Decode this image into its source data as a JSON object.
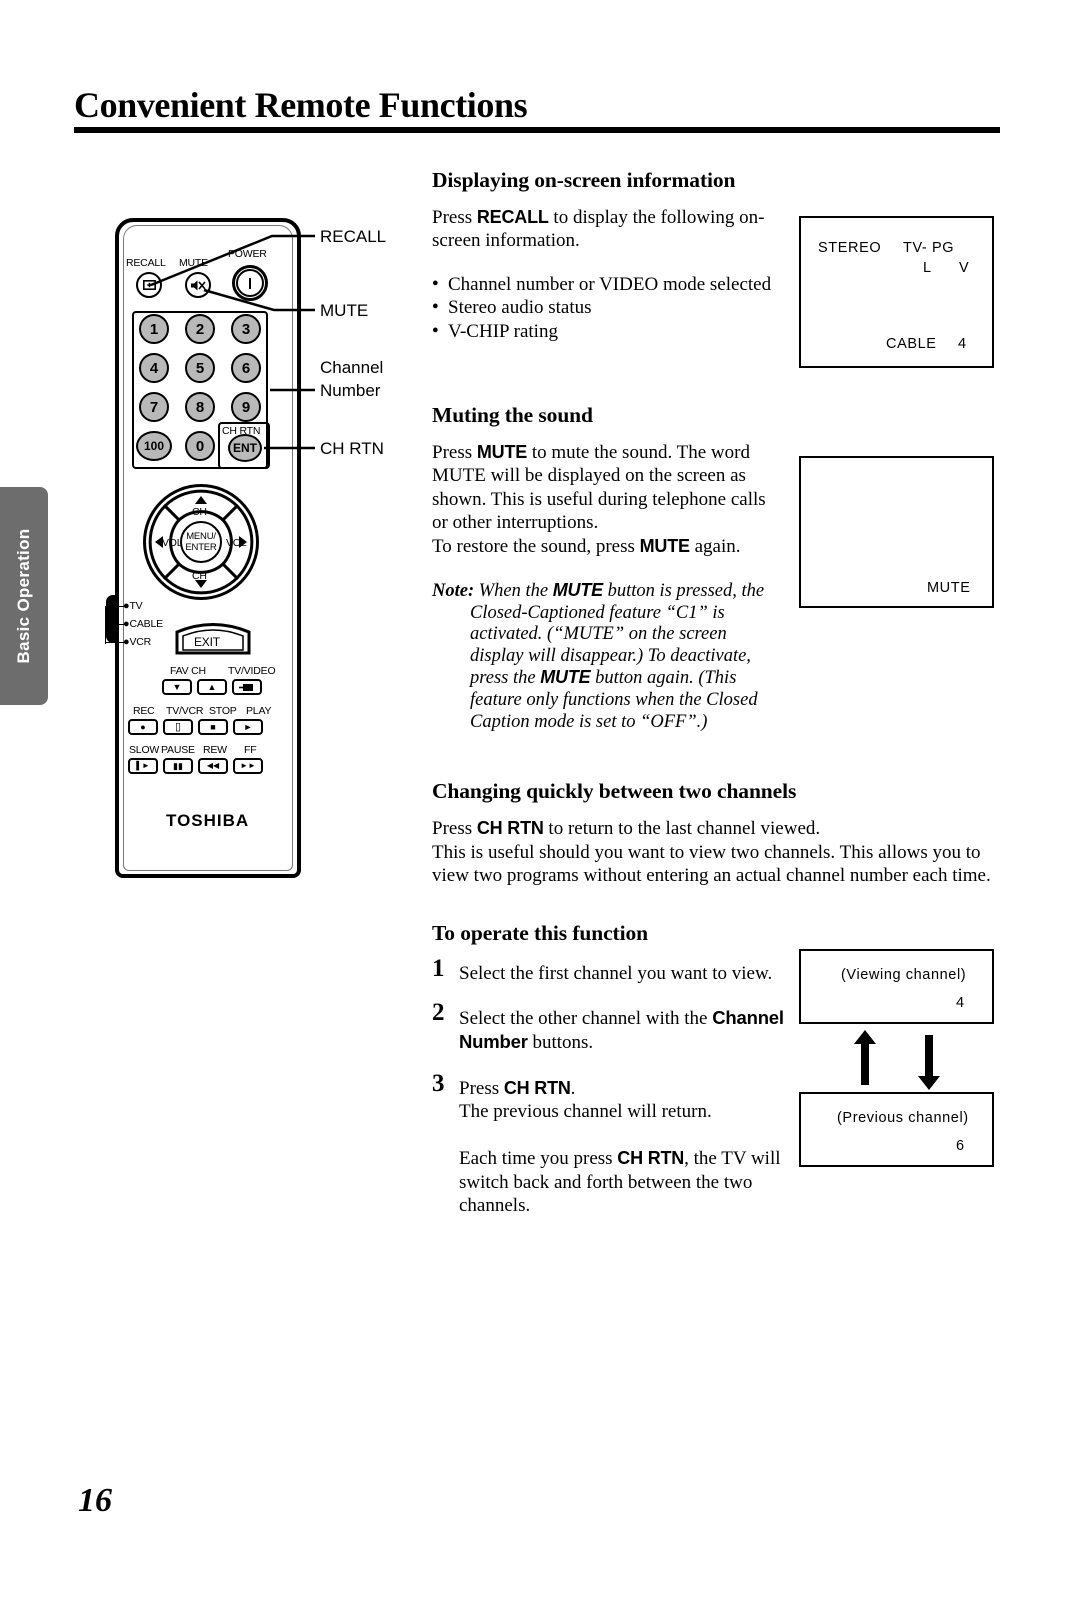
{
  "header": {
    "title": "Convenient Remote Functions"
  },
  "side_tab": {
    "label": "Basic Operation"
  },
  "page_number": "16",
  "sections": {
    "displaying": {
      "heading": "Displaying on-screen information",
      "intro_pre": "Press ",
      "intro_kbd": "RECALL",
      "intro_post": " to display the following on-screen information.",
      "bullets": [
        "Channel number or VIDEO mode selected",
        "Stereo audio status",
        "V-CHIP rating"
      ]
    },
    "muting": {
      "heading": "Muting the sound",
      "p1_a": "Press ",
      "p1_kbd": "MUTE",
      "p1_b": " to mute the sound. The word  MUTE  will be displayed on the screen as shown. This is useful during telephone calls or other interruptions.",
      "p2_a": "To restore the sound, press ",
      "p2_kbd": "MUTE",
      "p2_b": " again.",
      "note_label": "Note:",
      "note_a": " When the ",
      "note_kbd1": "MUTE",
      "note_b": " button is pressed, the Closed-Captioned feature “C1” is activated. (“MUTE” on the screen display will disappear.) To deactivate, press the ",
      "note_kbd2": "MUTE",
      "note_c": " button again. (This feature only functions when the Closed Caption mode is set to “OFF”.)"
    },
    "changing": {
      "heading": "Changing quickly between two channels",
      "p1_a": "Press ",
      "p1_kbd": "CH RTN",
      "p1_b": " to return to the last channel viewed.",
      "p2": "This is useful should you want to view two channels. This allows you to view two programs without entering an actual channel number each time."
    },
    "operate": {
      "heading": "To operate this function",
      "steps": [
        {
          "num": "1",
          "text_a": "Select the first channel you want to view.",
          "kbd": "",
          "text_b": ""
        },
        {
          "num": "2",
          "text_a": "Select the other channel with the ",
          "kbd": "Channel Number",
          "text_b": " buttons."
        },
        {
          "num": "3",
          "text_a": "Press ",
          "kbd": "CH RTN",
          "text_b": "."
        }
      ],
      "step3_sub": "The previous channel will return.",
      "closing_a": "Each time you press ",
      "closing_kbd": "CH RTN",
      "closing_b": ", the TV will switch back and forth between the two channels."
    }
  },
  "tv_screens": {
    "recall": {
      "stereo": "STEREO",
      "rating": "TV- PG",
      "sub_l": "L",
      "sub_v": "V",
      "source": "CABLE",
      "channel": "4"
    },
    "mute": {
      "label": "MUTE"
    },
    "viewing": {
      "caption": "(Viewing channel)",
      "channel": "4"
    },
    "previous": {
      "caption": "(Previous channel)",
      "channel": "6"
    }
  },
  "remote": {
    "callouts": [
      {
        "label": "RECALL"
      },
      {
        "label": "MUTE"
      },
      {
        "label": "Channel"
      },
      {
        "label": "Number"
      },
      {
        "label": "CH RTN"
      }
    ],
    "top_labels": {
      "recall": "RECALL",
      "mute": "MUTE",
      "power": "POWER"
    },
    "keypad": [
      "1",
      "2",
      "3",
      "4",
      "5",
      "6",
      "7",
      "8",
      "9",
      "100",
      "0",
      "ENT"
    ],
    "ent_label": "CH RTN",
    "dpad": {
      "ch_up": "CH",
      "ch_down": "CH",
      "vol_left": "VOL",
      "vol_right": "VOL",
      "center_1": "MENU/",
      "center_2": "ENTER"
    },
    "mode_labels": [
      "TV",
      "CABLE",
      "VCR"
    ],
    "exit": "EXIT",
    "fav_tv": {
      "fav_ch": "FAV CH",
      "tv_video": "TV/VIDEO"
    },
    "vcr_row1": [
      "REC",
      "TV/VCR",
      "STOP",
      "PLAY"
    ],
    "vcr_row2": [
      "SLOW",
      "PAUSE",
      "REW",
      "FF"
    ],
    "brand": "TOSHIBA"
  }
}
